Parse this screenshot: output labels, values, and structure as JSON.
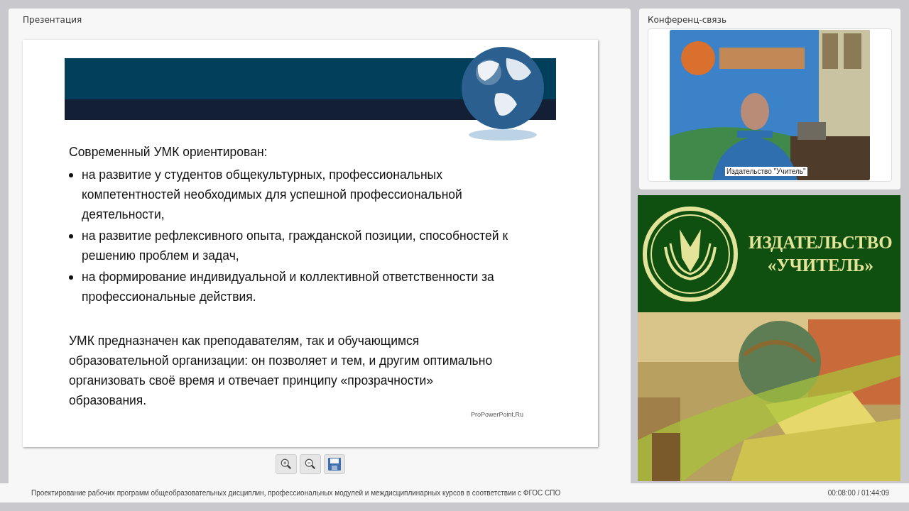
{
  "presentation": {
    "title": "Презентация",
    "slide": {
      "heading": "Современный УМК ориентирован:",
      "bullets": [
        "на развитие у студентов общекультурных, профессиональных компетентностей необходимых для успешной профессиональной деятельности,",
        "на развитие рефлексивного опыта, гражданской позиции, способностей к решению проблем и задач,",
        "на формирование индивидуальной и коллективной ответственности за профессиональные действия."
      ],
      "paragraph": "УМК предназначен как преподавателям, так и обучающимся образовательной организации: он позволяет и тем, и другим оптимально организовать своё время и отвечает принципу «прозрачности» образования.",
      "credit": "ProPowerPoint.Ru"
    },
    "tools": [
      {
        "kind": "zoom-in"
      },
      {
        "kind": "zoom-out"
      },
      {
        "kind": "save"
      }
    ]
  },
  "conference": {
    "title": "Конференц-связь",
    "speaker_label": "Издательство \"Учитель\""
  },
  "banner": {
    "line_1": "ИЗДАТЕЛЬСТВО",
    "line_2": "«УЧИТЕЛЬ»"
  },
  "status_bar": {
    "course_title": "Проектирование рабочих программ общеобразовательных дисциплин, профессиональных модулей и междисциплинарных курсов в соответствии с ФГОС СПО",
    "time": "00:08:00 / 01:44:09"
  }
}
